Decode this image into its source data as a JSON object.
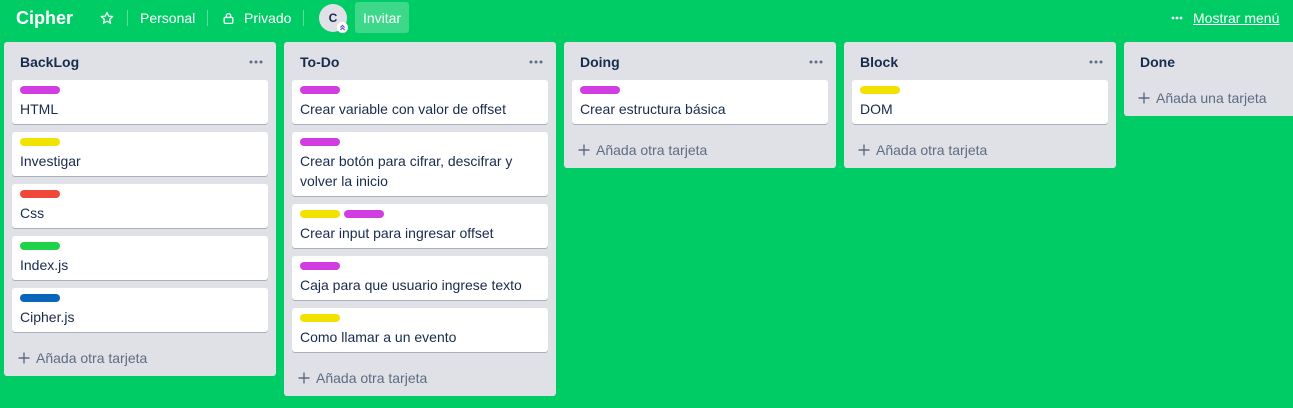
{
  "colors": {
    "board_bg": "#00cc66",
    "list_bg": "#dfe1e6",
    "label_purple": "#d13de0",
    "label_yellow": "#f2e200",
    "label_red": "#f0493a",
    "label_green": "#1ed348",
    "label_blue": "#0a66b8"
  },
  "header": {
    "board_title": "Cipher",
    "star_icon": "star-icon",
    "team": "Personal",
    "visibility_icon": "lock-icon",
    "visibility": "Privado",
    "avatar_initial": "C",
    "invite": "Invitar",
    "menu_icon": "ellipsis-icon",
    "show_menu": "Mostrar menú"
  },
  "lists": [
    {
      "title": "BackLog",
      "cards": [
        {
          "labels": [
            "purple"
          ],
          "title": "HTML"
        },
        {
          "labels": [
            "yellow"
          ],
          "title": "Investigar"
        },
        {
          "labels": [
            "red"
          ],
          "title": "Css"
        },
        {
          "labels": [
            "green"
          ],
          "title": "Index.js"
        },
        {
          "labels": [
            "blue"
          ],
          "title": "Cipher.js"
        }
      ],
      "add_label": "Añada otra tarjeta"
    },
    {
      "title": "To-Do",
      "cards": [
        {
          "labels": [
            "purple"
          ],
          "title": "Crear variable con valor de offset"
        },
        {
          "labels": [
            "purple"
          ],
          "title": "Crear botón para cifrar, descifrar y volver la inicio"
        },
        {
          "labels": [
            "yellow",
            "purple"
          ],
          "title": "Crear input para ingresar offset"
        },
        {
          "labels": [
            "purple"
          ],
          "title": "Caja para que usuario ingrese texto"
        },
        {
          "labels": [
            "yellow"
          ],
          "title": "Como llamar a un evento"
        }
      ],
      "add_label": "Añada otra tarjeta"
    },
    {
      "title": "Doing",
      "cards": [
        {
          "labels": [
            "purple"
          ],
          "title": "Crear estructura básica"
        }
      ],
      "add_label": "Añada otra tarjeta"
    },
    {
      "title": "Block",
      "cards": [
        {
          "labels": [
            "yellow"
          ],
          "title": "DOM"
        }
      ],
      "add_label": "Añada otra tarjeta"
    },
    {
      "title": "Done",
      "cards": [],
      "add_label": "Añada una tarjeta"
    }
  ]
}
